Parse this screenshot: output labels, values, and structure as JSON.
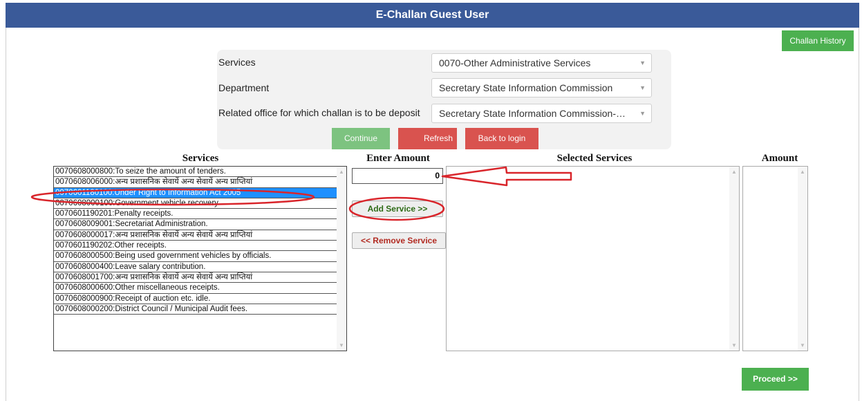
{
  "header": {
    "title": "E-Challan Guest User"
  },
  "buttons": {
    "challan_history": "Challan History",
    "continue": "Continue",
    "refresh": "Refresh",
    "back_to_login": "Back to login",
    "add_service": "Add Service >>",
    "remove_service": "<< Remove Service",
    "proceed": "Proceed >>"
  },
  "form": {
    "services_label": "Services",
    "services_value": "0070-Other Administrative Services",
    "department_label": "Department",
    "department_value": "Secretary State Information Commission",
    "office_label": "Related office for which challan is to be deposit",
    "office_value": "Secretary State Information Commission-…"
  },
  "columns": {
    "services": "Services",
    "enter_amount": "Enter Amount",
    "selected_services": "Selected Services",
    "amount": "Amount"
  },
  "amount_value": "0",
  "services_list": [
    "0070608000800:To seize the amount of tenders.",
    "0070608006000:अन्य प्रशासनिक सेवायें अन्य सेवायें अन्य प्राप्तियां",
    "0070601180100:Under Right to Information Act 2005",
    "0070608000100:Government vehicle recovery",
    "0070601190201:Penalty receipts.",
    "0070608009001:Secretariat Administration.",
    "0070608000017:अन्य प्रशासनिक सेवायें अन्य सेवायें अन्य प्राप्तियां",
    "0070601190202:Other receipts.",
    "0070608000500:Being used government vehicles by officials.",
    "0070608000400:Leave salary contribution.",
    "0070608001700:अन्य प्रशासनिक सेवायें अन्य सेवायें अन्य प्राप्तियां",
    "0070608000600:Other miscellaneous receipts.",
    "0070608000900:Receipt of auction etc. idle.",
    "0070608000200:District Council / Municipal Audit fees."
  ],
  "selected_index": 2,
  "colors": {
    "header": "#3a5a99",
    "green": "#4cb050",
    "red": "#d9534f",
    "annotation": "#d9252b",
    "selection": "#1e90ff"
  }
}
